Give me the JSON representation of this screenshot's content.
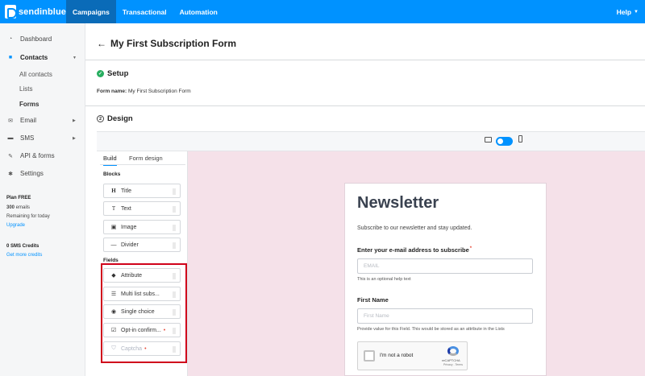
{
  "topbar": {
    "logo_text": "sendinblue",
    "nav": [
      "Campaigns",
      "Transactional",
      "Automation"
    ],
    "help_label": "Help",
    "accent_color": "#0092ff"
  },
  "sidebar": {
    "items": [
      {
        "label": "Dashboard",
        "icon": "dashboard-icon"
      },
      {
        "label": "Contacts",
        "icon": "contacts-icon"
      },
      {
        "label": "Email",
        "icon": "email-icon"
      },
      {
        "label": "SMS",
        "icon": "sms-icon"
      },
      {
        "label": "API & forms",
        "icon": "wrench-icon"
      },
      {
        "label": "Settings",
        "icon": "gear-icon"
      }
    ],
    "contacts_sub": [
      "All contacts",
      "Lists",
      "Forms"
    ],
    "plan": {
      "title": "Plan FREE",
      "emails_count": "300",
      "emails_label": " emails",
      "remaining": "Remaining for today",
      "upgrade": "Upgrade"
    },
    "sms": {
      "credits": "0 SMS Credits",
      "get_more": "Get more credits"
    }
  },
  "page": {
    "title": "My First Subscription Form",
    "setup": {
      "heading": "Setup",
      "form_name_label": "Form name:",
      "form_name_value": "My First Subscription Form"
    },
    "design": {
      "number": "2",
      "heading": "Design"
    }
  },
  "builder": {
    "tabs": [
      "Build",
      "Form design"
    ],
    "blocks_heading": "Blocks",
    "blocks": [
      {
        "label": "Title",
        "icon": "heading-icon"
      },
      {
        "label": "Text",
        "icon": "text-icon"
      },
      {
        "label": "Image",
        "icon": "image-icon"
      },
      {
        "label": "Divider",
        "icon": "divider-icon"
      }
    ],
    "fields_heading": "Fields",
    "fields": [
      {
        "label": "Attribute",
        "icon": "tag-icon"
      },
      {
        "label": "Multi list subs...",
        "icon": "list-icon"
      },
      {
        "label": "Single choice",
        "icon": "radio-icon"
      },
      {
        "label": "Opt-in confirm...",
        "icon": "checkbox-icon"
      },
      {
        "label": "Captcha",
        "icon": "shield-icon"
      }
    ]
  },
  "preview": {
    "title": "Newsletter",
    "subtitle": "Subscribe to our newsletter and stay updated.",
    "email_label": "Enter your e-mail address to subscribe",
    "email_placeholder": "EMAIL",
    "email_help": "This is an optional help text",
    "firstname_label": "First Name",
    "firstname_placeholder": "First Name",
    "firstname_help": "Provide value for this Field. This would be stored as an attribute in the Lists",
    "captcha_text": "I'm not a robot",
    "captcha_brand": "reCAPTCHA",
    "captcha_terms": "Privacy - Terms"
  }
}
